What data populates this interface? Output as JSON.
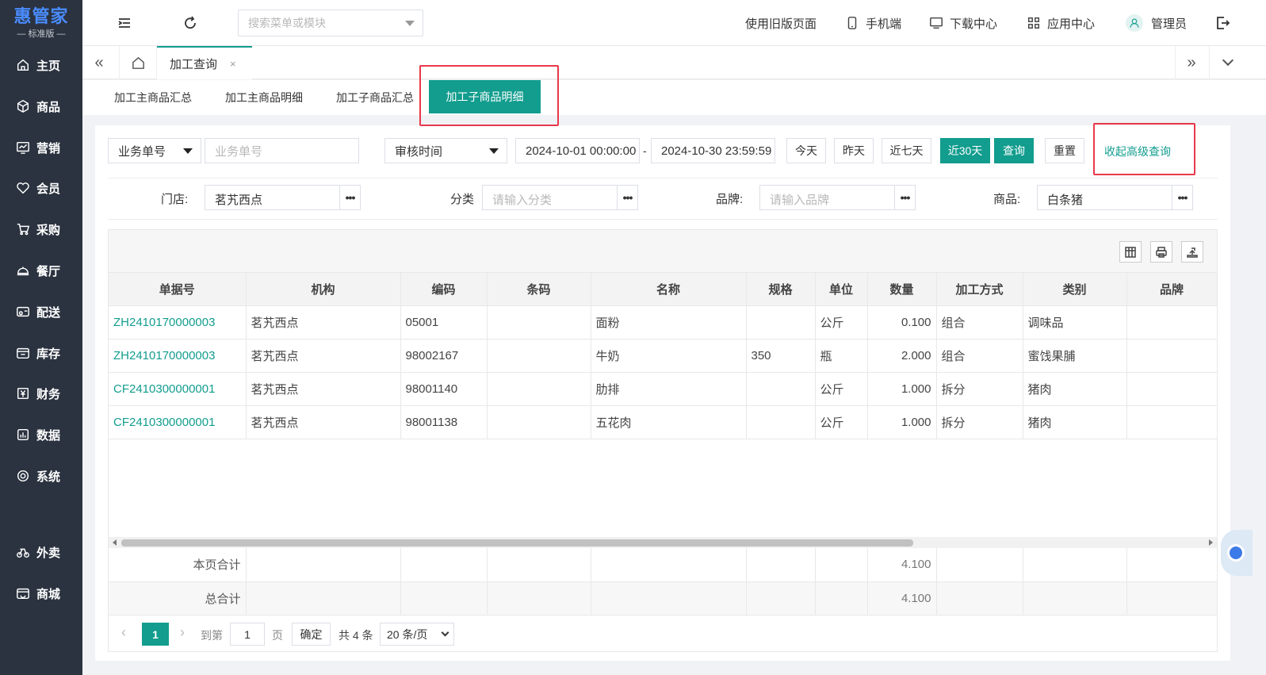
{
  "logo": {
    "name": "惠管家",
    "edition": "— 标准版 —"
  },
  "sidebar": {
    "items": [
      {
        "label": "主页",
        "icon": "home-icon"
      },
      {
        "label": "商品",
        "icon": "box-icon"
      },
      {
        "label": "营销",
        "icon": "chart-icon"
      },
      {
        "label": "会员",
        "icon": "heart-icon"
      },
      {
        "label": "采购",
        "icon": "cart-icon"
      },
      {
        "label": "餐厅",
        "icon": "cloche-icon"
      },
      {
        "label": "配送",
        "icon": "truck-icon"
      },
      {
        "label": "库存",
        "icon": "warehouse-icon"
      },
      {
        "label": "财务",
        "icon": "yen-icon"
      },
      {
        "label": "数据",
        "icon": "data-icon"
      },
      {
        "label": "系统",
        "icon": "settings-icon"
      },
      {
        "label": "外卖",
        "icon": "scooter-icon"
      },
      {
        "label": "商城",
        "icon": "store-icon"
      }
    ]
  },
  "topbar": {
    "search_placeholder": "搜索菜单或模块",
    "old_page": "使用旧版页面",
    "mobile": "手机端",
    "download": "下载中心",
    "apps": "应用中心",
    "user": "管理员"
  },
  "tabs": {
    "active": "加工查询",
    "close": "×",
    "collapse": "«",
    "expand": "»"
  },
  "subtabs": [
    "加工主商品汇总",
    "加工主商品明细",
    "加工子商品汇总",
    "加工子商品明细"
  ],
  "filters": {
    "doc_type": "业务单号",
    "doc_placeholder": "业务单号",
    "time_type": "审核时间",
    "date_from": "2024-10-01 00:00:00",
    "date_sep": "-",
    "date_to": "2024-10-30 23:59:59",
    "btn_today": "今天",
    "btn_yesterday": "昨天",
    "btn_7days": "近七天",
    "btn_30days": "近30天",
    "btn_query": "查询",
    "btn_reset": "重置",
    "toggle_advanced": "收起高级查询",
    "store_label": "门店:",
    "store_value": "茗艽西点",
    "category_label": "分类",
    "category_placeholder": "请输入分类",
    "brand_label": "品牌:",
    "brand_placeholder": "请输入品牌",
    "product_label": "商品:",
    "product_value": "白条猪",
    "more": "•••"
  },
  "table": {
    "columns": [
      "单据号",
      "机构",
      "编码",
      "条码",
      "名称",
      "规格",
      "单位",
      "数量",
      "加工方式",
      "类别",
      "品牌"
    ],
    "rows": [
      [
        "ZH2410170000003",
        "茗艽西点",
        "05001",
        "",
        "面粉",
        "",
        "公斤",
        "0.100",
        "组合",
        "调味品",
        ""
      ],
      [
        "ZH2410170000003",
        "茗艽西点",
        "98002167",
        "",
        "牛奶",
        "350",
        "瓶",
        "2.000",
        "组合",
        "蜜饯果脯",
        ""
      ],
      [
        "CF2410300000001",
        "茗艽西点",
        "98001140",
        "",
        "肋排",
        "",
        "公斤",
        "1.000",
        "拆分",
        "猪肉",
        ""
      ],
      [
        "CF2410300000001",
        "茗艽西点",
        "98001138",
        "",
        "五花肉",
        "",
        "公斤",
        "1.000",
        "拆分",
        "猪肉",
        ""
      ]
    ],
    "page_total_label": "本页合计",
    "page_total_qty": "4.100",
    "grand_total_label": "总合计",
    "grand_total_qty": "4.100"
  },
  "pager": {
    "current": "1",
    "goto_label": "到第",
    "goto_value": "1",
    "page_unit": "页",
    "confirm": "确定",
    "total": "共 4 条",
    "page_size": "20 条/页"
  },
  "colors": {
    "primary": "#129d8e",
    "sidebar": "#2b3340",
    "highlight": "#e8394b"
  }
}
